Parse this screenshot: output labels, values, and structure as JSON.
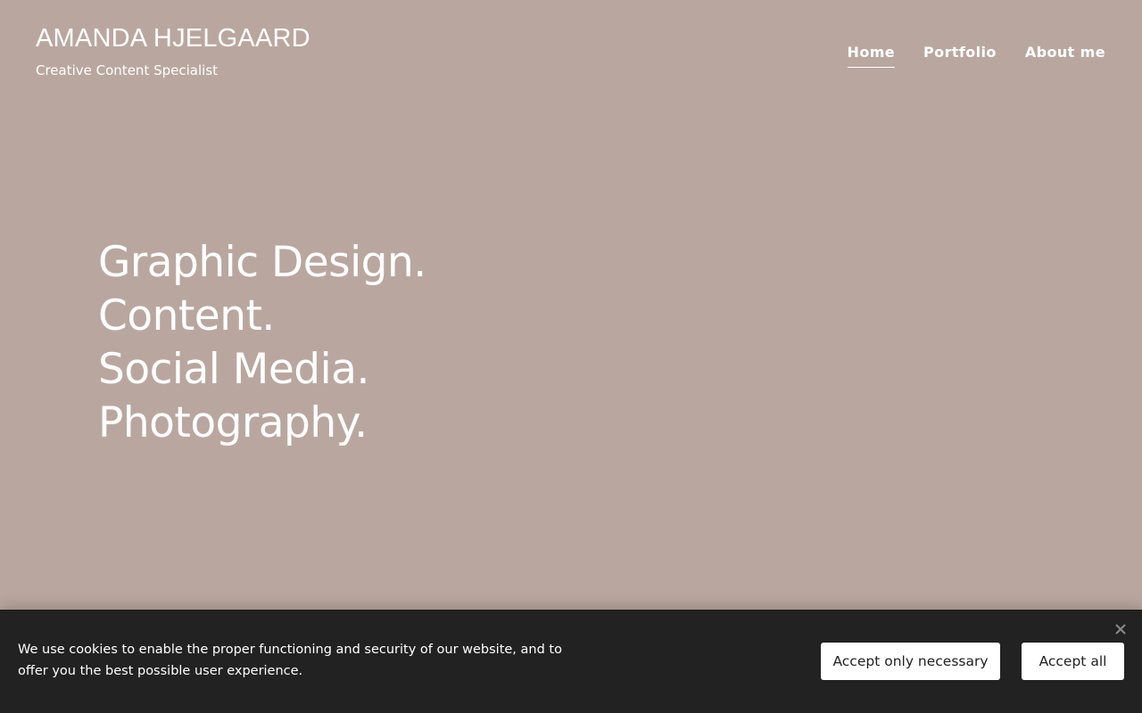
{
  "header": {
    "brand_name": "AMANDA HJELGAARD",
    "tagline": "Creative Content Specialist"
  },
  "nav": {
    "items": [
      {
        "label": "Home",
        "active": true
      },
      {
        "label": "Portfolio",
        "active": false
      },
      {
        "label": "About me",
        "active": false
      }
    ]
  },
  "hero": {
    "lines": [
      "Graphic Design.",
      "Content.",
      "Social Media.",
      "Photography."
    ]
  },
  "cookie_banner": {
    "message": "We use cookies to enable the proper functioning and security of our website, and to offer you the best possible user experience.",
    "accept_necessary_label": "Accept only necessary",
    "accept_all_label": "Accept all",
    "close_icon": "close-icon"
  },
  "colors": {
    "background": "#b9a79f",
    "text": "#ffffff",
    "cookie_bar": "#222222",
    "button_bg": "#ffffff",
    "button_text": "#222222"
  }
}
